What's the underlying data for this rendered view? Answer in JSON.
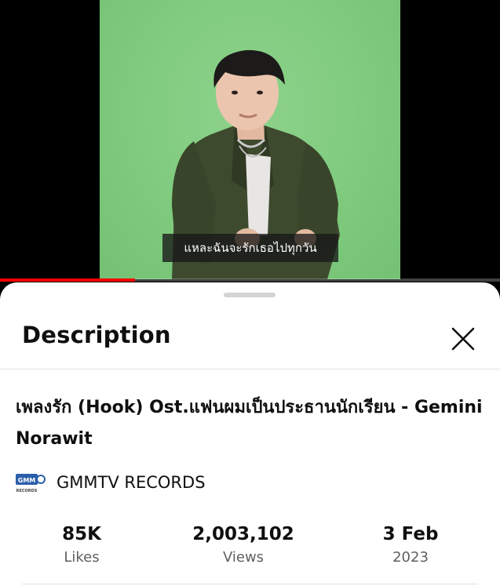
{
  "player": {
    "subtitle": "แหละฉันจะรักเธอไปทุกวัน",
    "progress_fraction": 0.27,
    "progress_color": "#ff0000",
    "background_color": "#7fcb7e"
  },
  "description_panel": {
    "title": "Description",
    "close_icon": "close-icon",
    "video_title": "เพลงรัก (Hook) Ost.แฟนผมเป็นประธานนักเรียน - Gemini Norawit",
    "channel": {
      "logo_text": "GMM",
      "logo_subtext": "RECORDS",
      "name": "GMMTV RECORDS"
    },
    "stats": [
      {
        "value": "85K",
        "label": "Likes"
      },
      {
        "value": "2,003,102",
        "label": "Views"
      },
      {
        "value": "3 Feb",
        "label": "2023"
      }
    ]
  }
}
